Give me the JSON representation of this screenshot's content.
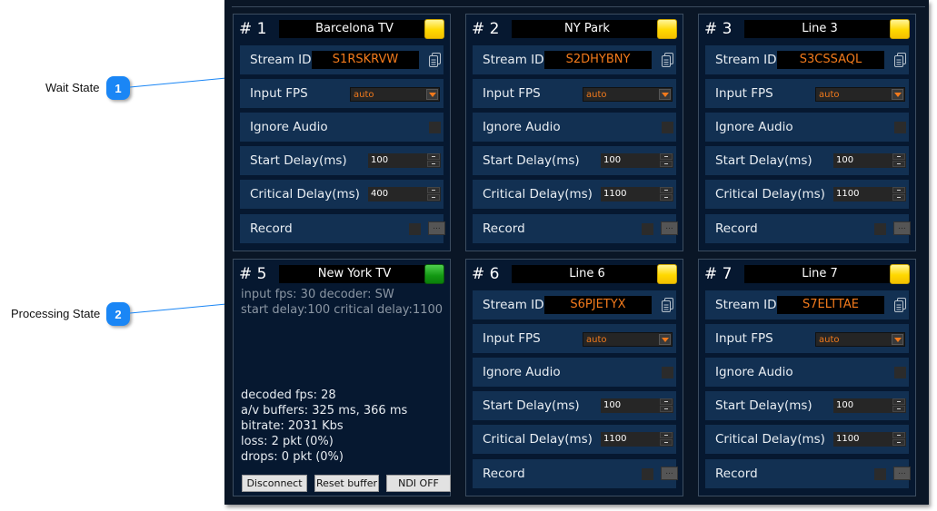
{
  "callouts": [
    {
      "number": "1",
      "label": "Wait State"
    },
    {
      "number": "2",
      "label": "Processing State"
    }
  ],
  "labels": {
    "stream_id": "Stream ID",
    "input_fps": "Input FPS",
    "ignore_audio": "Ignore Audio",
    "start_delay": "Start Delay(ms)",
    "critical_delay": "Critical Delay(ms)",
    "record": "Record",
    "record_browse": "..."
  },
  "colors": {
    "accent_orange": "#f27a1c",
    "led_wait": "#ffd800",
    "led_processing": "#129812",
    "callout_blue": "#1a86f5"
  },
  "panels": [
    {
      "num": "# 1",
      "name": "Barcelona TV",
      "state": "wait",
      "led": "yellow",
      "stream_id": "S1RSKRVW",
      "input_fps": "auto",
      "ignore_audio": false,
      "start_delay": "100",
      "critical_delay": "400",
      "record": false
    },
    {
      "num": "# 2",
      "name": "NY Park",
      "state": "wait",
      "led": "yellow",
      "stream_id": "S2DHYBNY",
      "input_fps": "auto",
      "ignore_audio": false,
      "start_delay": "100",
      "critical_delay": "1100",
      "record": false
    },
    {
      "num": "# 3",
      "name": "Line 3",
      "state": "wait",
      "led": "yellow",
      "stream_id": "S3CSSAQL",
      "input_fps": "auto",
      "ignore_audio": false,
      "start_delay": "100",
      "critical_delay": "1100",
      "record": false
    },
    {
      "num": "# 5",
      "name": "New York TV",
      "state": "processing",
      "led": "green",
      "info": [
        "input fps: 30  decoder: SW",
        "start delay:100  critical delay:1100"
      ],
      "stats": [
        "decoded fps: 28",
        "a/v buffers: 325 ms, 366 ms",
        "bitrate: 2031 Kbs",
        "loss: 2 pkt (0%)",
        "drops: 0 pkt (0%)"
      ],
      "buttons": [
        "Disconnect",
        "Reset buffer",
        "NDI OFF"
      ]
    },
    {
      "num": "# 6",
      "name": "Line 6",
      "state": "wait",
      "led": "yellow",
      "stream_id": "S6PJETYX",
      "input_fps": "auto",
      "ignore_audio": false,
      "start_delay": "100",
      "critical_delay": "1100",
      "record": false
    },
    {
      "num": "# 7",
      "name": "Line 7",
      "state": "wait",
      "led": "yellow",
      "stream_id": "S7ELTTAE",
      "input_fps": "auto",
      "ignore_audio": false,
      "start_delay": "100",
      "critical_delay": "1100",
      "record": false
    }
  ]
}
